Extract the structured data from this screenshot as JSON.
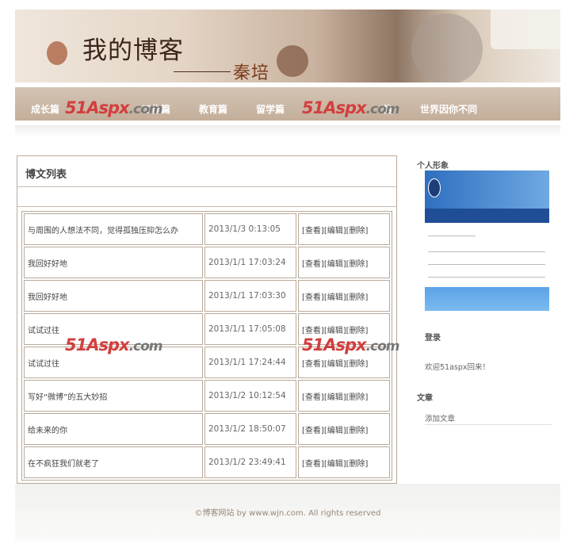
{
  "banner": {
    "title": "我的博客",
    "author": "秦培"
  },
  "nav": {
    "items": [
      {
        "label": "成长篇"
      },
      {
        "label": "工作篇"
      },
      {
        "label": "教育篇"
      },
      {
        "label": "留学篇"
      },
      {
        "label": "信"
      },
      {
        "label": "世界因你不同"
      }
    ]
  },
  "watermark": {
    "brand": "51Aspx",
    "domain": ".com"
  },
  "posts": {
    "heading": "博文列表",
    "rows": [
      {
        "title": "与周围的人想法不同，觉得孤独压抑怎么办",
        "date": "2013/1/3 0:13:05"
      },
      {
        "title": "我回好好地",
        "date": "2013/1/1 17:03:24"
      },
      {
        "title": "我回好好地",
        "date": "2013/1/1 17:03:30"
      },
      {
        "title": "试试过往",
        "date": "2013/1/1 17:05:08"
      },
      {
        "title": "试试过往",
        "date": "2013/1/1 17:24:44"
      },
      {
        "title": "写好“微博”的五大妙招",
        "date": "2013/1/2 10:12:54"
      },
      {
        "title": "给未来的你",
        "date": "2013/1/2 18:50:07"
      },
      {
        "title": "在不疯狂我们就老了",
        "date": "2013/1/2 23:49:41"
      }
    ],
    "actions": {
      "view": "[查看]",
      "edit": "[编辑]",
      "delete": "[删除]"
    }
  },
  "sidebar": {
    "profile_title": "个人形象",
    "login_title": "登录",
    "welcome": "欢迎51aspx回来！",
    "article_title": "文章",
    "add_article": "添加文章"
  },
  "footer": {
    "text": "©博客网站 by www.wjn.com. All rights reserved"
  }
}
